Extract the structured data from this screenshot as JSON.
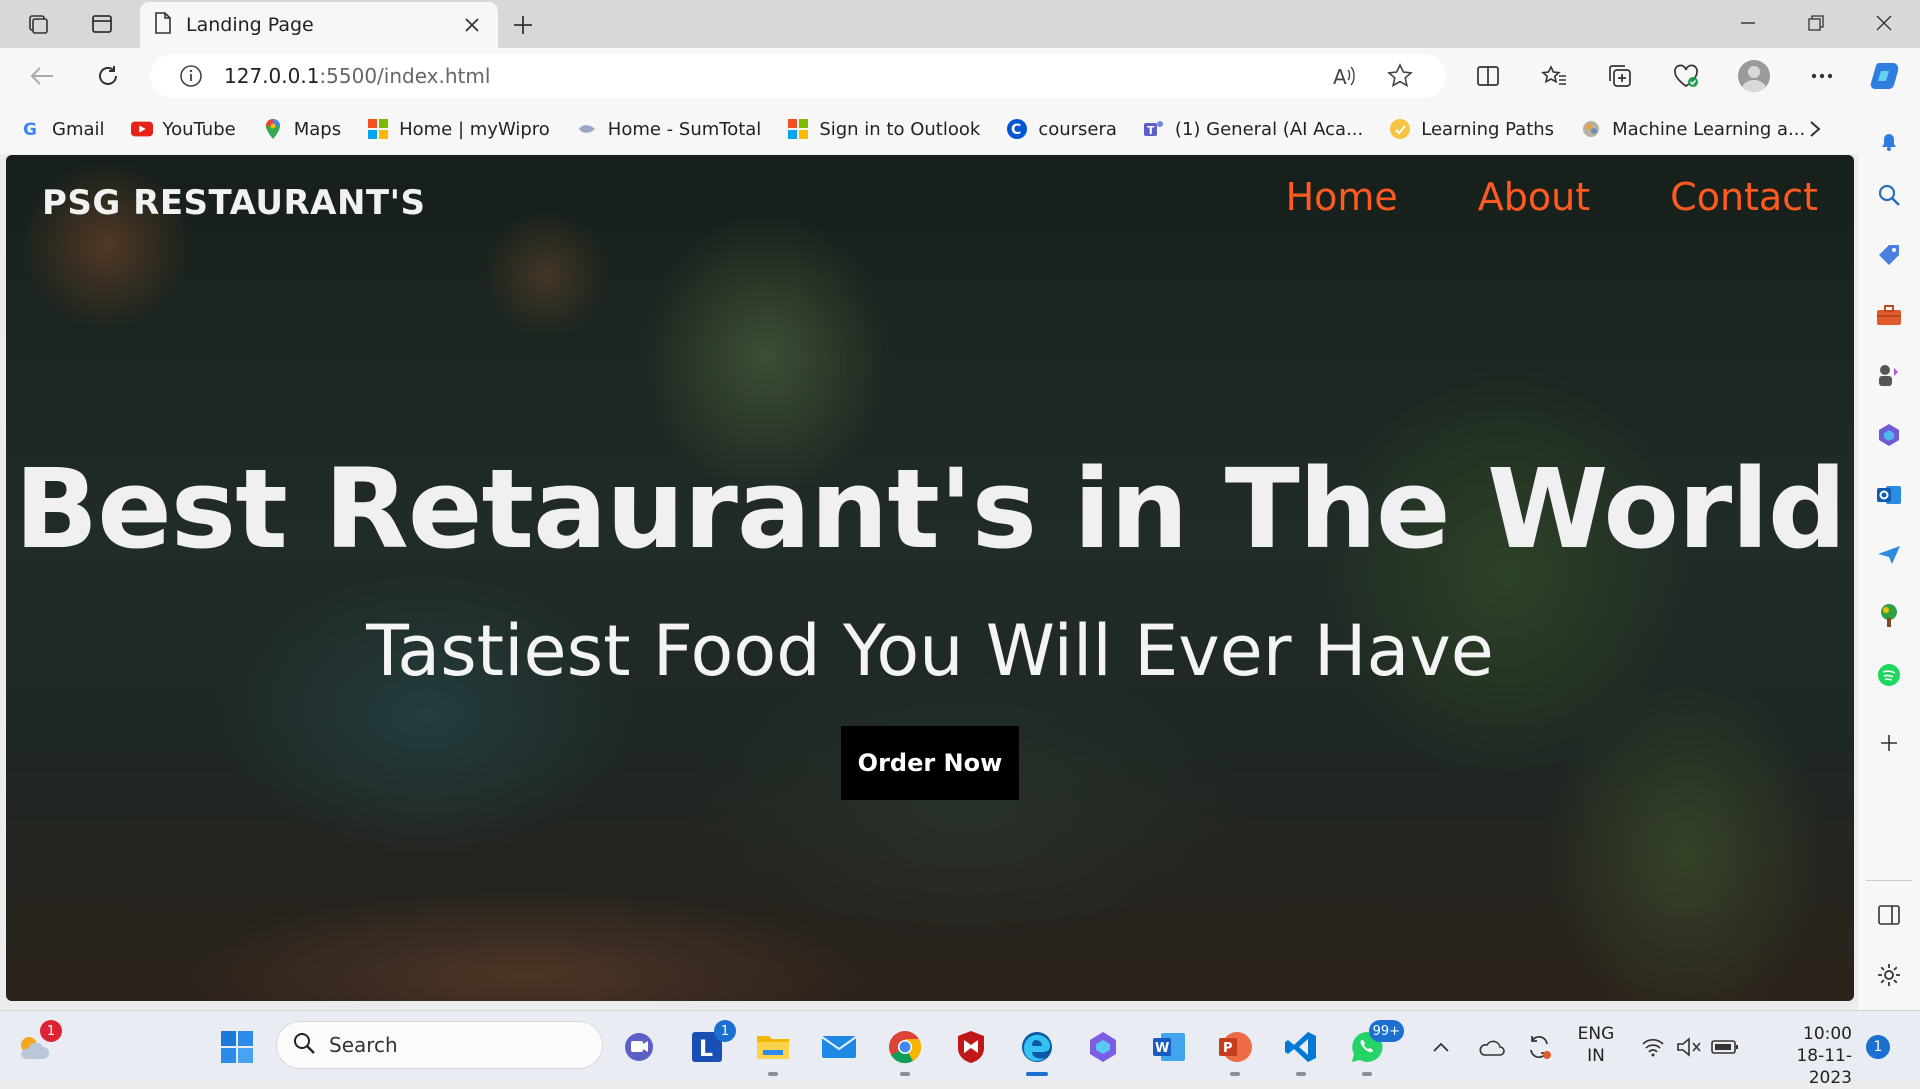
{
  "browser": {
    "tab_title": "Landing Page",
    "url_host": "127.0.0.1",
    "url_rest": ":5500/index.html"
  },
  "bookmarks": [
    {
      "label": "Gmail",
      "icon": "google-icon"
    },
    {
      "label": "YouTube",
      "icon": "youtube-icon"
    },
    {
      "label": "Maps",
      "icon": "maps-icon"
    },
    {
      "label": "Home | myWipro",
      "icon": "microsoft-icon"
    },
    {
      "label": "Home - SumTotal",
      "icon": "sumtotal-icon"
    },
    {
      "label": "Sign in to Outlook",
      "icon": "microsoft-icon"
    },
    {
      "label": "coursera",
      "icon": "coursera-icon"
    },
    {
      "label": "(1) General (AI Aca...",
      "icon": "teams-icon"
    },
    {
      "label": "Learning Paths",
      "icon": "learning-icon"
    },
    {
      "label": "Machine Learning a...",
      "icon": "ml-icon"
    }
  ],
  "page": {
    "brand": "PSG RESTAURANT'S",
    "nav": [
      "Home",
      "About",
      "Contact"
    ],
    "hero_title": "Best Retaurant's in The World",
    "hero_subtitle": "Tastiest Food You Will Ever Have",
    "cta_label": "Order Now"
  },
  "taskbar": {
    "search_placeholder": "Search",
    "weather_badge": "1",
    "outlook_badge": "1",
    "whatsapp_badge": "99+",
    "language": "ENG",
    "region": "IN",
    "time": "10:00",
    "date": "18-11-2023",
    "notification_count": "1"
  },
  "colors": {
    "nav_link": "#ff5a1f",
    "hero_text": "#f0f0f2",
    "cta_bg": "#000000"
  }
}
